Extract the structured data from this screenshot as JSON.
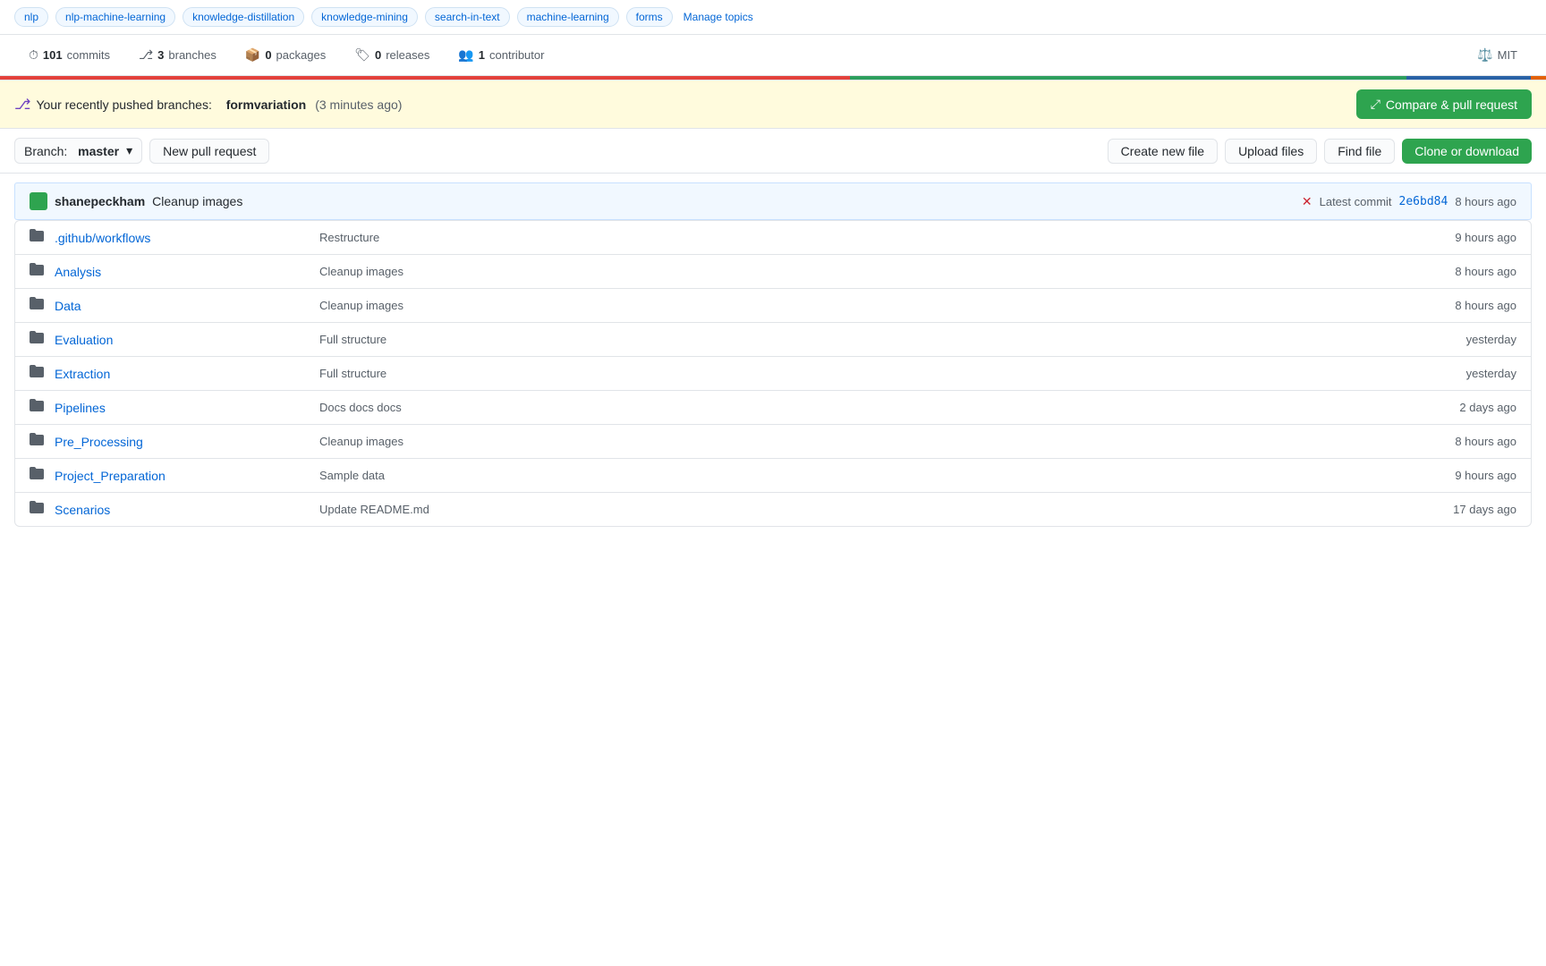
{
  "tags": {
    "items": [
      "nlp",
      "nlp-machine-learning",
      "knowledge-distillation",
      "knowledge-mining",
      "search-in-text",
      "machine-learning",
      "forms"
    ],
    "manage_label": "Manage topics"
  },
  "stats": {
    "commits_count": "101",
    "commits_label": "commits",
    "branches_count": "3",
    "branches_label": "branches",
    "packages_count": "0",
    "packages_label": "packages",
    "releases_count": "0",
    "releases_label": "releases",
    "contributors_count": "1",
    "contributors_label": "contributor",
    "license": "MIT"
  },
  "push_notif": {
    "prefix": "Your recently pushed branches:",
    "branch": "formvariation",
    "time": "(3 minutes ago)",
    "compare_label": "Compare & pull request"
  },
  "toolbar": {
    "branch_prefix": "Branch:",
    "branch_name": "master",
    "new_pr_label": "New pull request",
    "create_label": "Create new file",
    "upload_label": "Upload files",
    "find_label": "Find file",
    "clone_label": "Clone or download"
  },
  "commit_bar": {
    "author": "shanepeckham",
    "message": "Cleanup images",
    "latest_label": "Latest commit",
    "hash": "2e6bd84",
    "time": "8 hours ago"
  },
  "files": [
    {
      "name": ".github/",
      "link_part": "workflows",
      "commit": "Restructure",
      "time": "9 hours ago",
      "is_folder": true
    },
    {
      "name": "Analysis",
      "commit": "Cleanup images",
      "time": "8 hours ago",
      "is_folder": true
    },
    {
      "name": "Data",
      "commit": "Cleanup images",
      "time": "8 hours ago",
      "is_folder": true
    },
    {
      "name": "Evaluation",
      "commit": "Full structure",
      "time": "yesterday",
      "is_folder": true
    },
    {
      "name": "Extraction",
      "commit": "Full structure",
      "time": "yesterday",
      "is_folder": true
    },
    {
      "name": "Pipelines",
      "commit": "Docs docs docs",
      "time": "2 days ago",
      "is_folder": true
    },
    {
      "name": "Pre_Processing",
      "commit": "Cleanup images",
      "time": "8 hours ago",
      "is_folder": true
    },
    {
      "name": "Project_Preparation",
      "commit": "Sample data",
      "time": "9 hours ago",
      "is_folder": true
    },
    {
      "name": "Scenarios",
      "commit": "Update README.md",
      "time": "17 days ago",
      "is_folder": true
    }
  ],
  "colors": {
    "green": "#2ea44f",
    "blue": "#0366d6",
    "red": "#cb2431"
  }
}
